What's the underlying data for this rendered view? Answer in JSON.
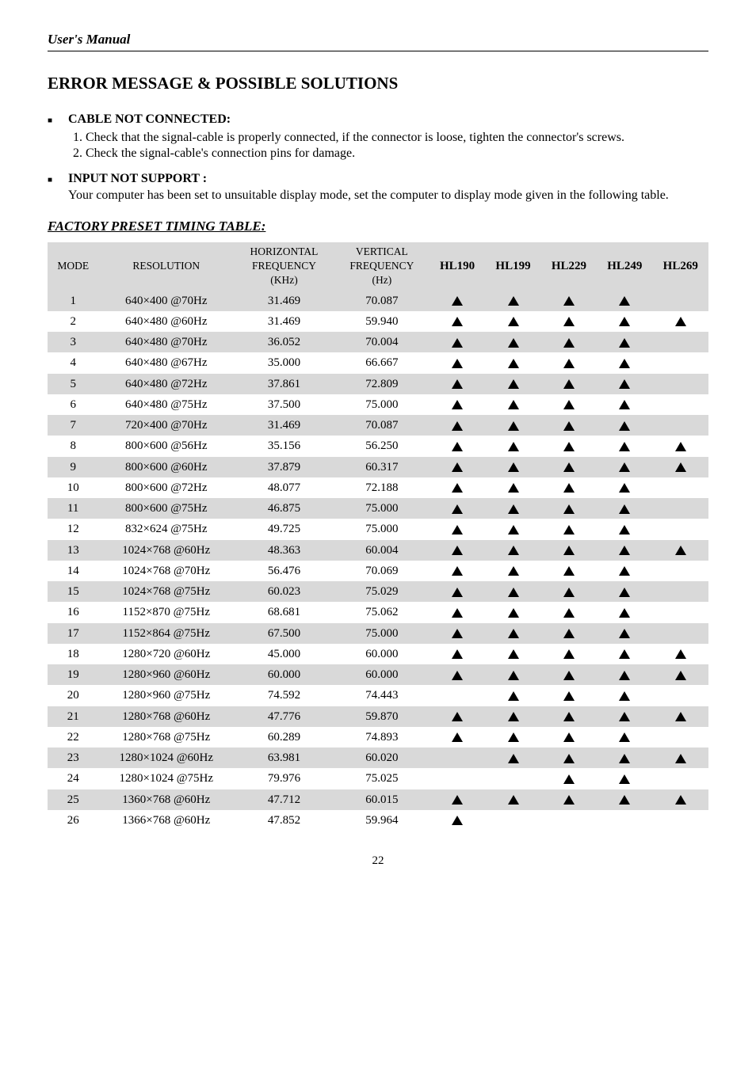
{
  "header": {
    "manual_title": "User's Manual"
  },
  "title": "ERROR MESSAGE & POSSIBLE SOLUTIONS",
  "sections": [
    {
      "heading": "CABLE NOT CONNECTED:",
      "items": [
        "Check that the signal-cable is properly connected, if the connector is loose, tighten the connector's screws.",
        "Check the signal-cable's connection pins for damage."
      ]
    },
    {
      "heading": "INPUT NOT SUPPORT :",
      "paragraph": "Your computer has been set to unsuitable display mode, set the computer to display mode given in the following table."
    }
  ],
  "table_title": "FACTORY PRESET TIMING TABLE:",
  "columns": {
    "mode": "MODE",
    "resolution": "RESOLUTION",
    "hfreq_top": "HORIZONTAL",
    "hfreq_mid": "FREQUENCY",
    "hfreq_unit": "(KHz)",
    "vfreq_top": "VERTICAL",
    "vfreq_mid": "FREQUENCY",
    "vfreq_unit": "(Hz)",
    "models": [
      "HL190",
      "HL199",
      "HL229",
      "HL249",
      "HL269"
    ]
  },
  "chart_data": {
    "type": "table",
    "rows": [
      {
        "mode": 1,
        "resolution": "640×400 @70Hz",
        "hfreq": "31.469",
        "vfreq": "70.087",
        "HL190": true,
        "HL199": true,
        "HL229": true,
        "HL249": true,
        "HL269": false
      },
      {
        "mode": 2,
        "resolution": "640×480 @60Hz",
        "hfreq": "31.469",
        "vfreq": "59.940",
        "HL190": true,
        "HL199": true,
        "HL229": true,
        "HL249": true,
        "HL269": true
      },
      {
        "mode": 3,
        "resolution": "640×480 @70Hz",
        "hfreq": "36.052",
        "vfreq": "70.004",
        "HL190": true,
        "HL199": true,
        "HL229": true,
        "HL249": true,
        "HL269": false
      },
      {
        "mode": 4,
        "resolution": "640×480 @67Hz",
        "hfreq": "35.000",
        "vfreq": "66.667",
        "HL190": true,
        "HL199": true,
        "HL229": true,
        "HL249": true,
        "HL269": false
      },
      {
        "mode": 5,
        "resolution": "640×480 @72Hz",
        "hfreq": "37.861",
        "vfreq": "72.809",
        "HL190": true,
        "HL199": true,
        "HL229": true,
        "HL249": true,
        "HL269": false
      },
      {
        "mode": 6,
        "resolution": "640×480 @75Hz",
        "hfreq": "37.500",
        "vfreq": "75.000",
        "HL190": true,
        "HL199": true,
        "HL229": true,
        "HL249": true,
        "HL269": false
      },
      {
        "mode": 7,
        "resolution": "720×400 @70Hz",
        "hfreq": "31.469",
        "vfreq": "70.087",
        "HL190": true,
        "HL199": true,
        "HL229": true,
        "HL249": true,
        "HL269": false
      },
      {
        "mode": 8,
        "resolution": "800×600 @56Hz",
        "hfreq": "35.156",
        "vfreq": "56.250",
        "HL190": true,
        "HL199": true,
        "HL229": true,
        "HL249": true,
        "HL269": true
      },
      {
        "mode": 9,
        "resolution": "800×600 @60Hz",
        "hfreq": "37.879",
        "vfreq": "60.317",
        "HL190": true,
        "HL199": true,
        "HL229": true,
        "HL249": true,
        "HL269": true
      },
      {
        "mode": 10,
        "resolution": "800×600 @72Hz",
        "hfreq": "48.077",
        "vfreq": "72.188",
        "HL190": true,
        "HL199": true,
        "HL229": true,
        "HL249": true,
        "HL269": false
      },
      {
        "mode": 11,
        "resolution": "800×600 @75Hz",
        "hfreq": "46.875",
        "vfreq": "75.000",
        "HL190": true,
        "HL199": true,
        "HL229": true,
        "HL249": true,
        "HL269": false
      },
      {
        "mode": 12,
        "resolution": "832×624 @75Hz",
        "hfreq": "49.725",
        "vfreq": "75.000",
        "HL190": true,
        "HL199": true,
        "HL229": true,
        "HL249": true,
        "HL269": false
      },
      {
        "mode": 13,
        "resolution": "1024×768 @60Hz",
        "hfreq": "48.363",
        "vfreq": "60.004",
        "HL190": true,
        "HL199": true,
        "HL229": true,
        "HL249": true,
        "HL269": true
      },
      {
        "mode": 14,
        "resolution": "1024×768 @70Hz",
        "hfreq": "56.476",
        "vfreq": "70.069",
        "HL190": true,
        "HL199": true,
        "HL229": true,
        "HL249": true,
        "HL269": false
      },
      {
        "mode": 15,
        "resolution": "1024×768 @75Hz",
        "hfreq": "60.023",
        "vfreq": "75.029",
        "HL190": true,
        "HL199": true,
        "HL229": true,
        "HL249": true,
        "HL269": false
      },
      {
        "mode": 16,
        "resolution": "1152×870 @75Hz",
        "hfreq": "68.681",
        "vfreq": "75.062",
        "HL190": true,
        "HL199": true,
        "HL229": true,
        "HL249": true,
        "HL269": false
      },
      {
        "mode": 17,
        "resolution": "1152×864 @75Hz",
        "hfreq": "67.500",
        "vfreq": "75.000",
        "HL190": true,
        "HL199": true,
        "HL229": true,
        "HL249": true,
        "HL269": false
      },
      {
        "mode": 18,
        "resolution": "1280×720 @60Hz",
        "hfreq": "45.000",
        "vfreq": "60.000",
        "HL190": true,
        "HL199": true,
        "HL229": true,
        "HL249": true,
        "HL269": true
      },
      {
        "mode": 19,
        "resolution": "1280×960 @60Hz",
        "hfreq": "60.000",
        "vfreq": "60.000",
        "HL190": true,
        "HL199": true,
        "HL229": true,
        "HL249": true,
        "HL269": true
      },
      {
        "mode": 20,
        "resolution": "1280×960 @75Hz",
        "hfreq": "74.592",
        "vfreq": "74.443",
        "HL190": false,
        "HL199": true,
        "HL229": true,
        "HL249": true,
        "HL269": false
      },
      {
        "mode": 21,
        "resolution": "1280×768 @60Hz",
        "hfreq": "47.776",
        "vfreq": "59.870",
        "HL190": true,
        "HL199": true,
        "HL229": true,
        "HL249": true,
        "HL269": true
      },
      {
        "mode": 22,
        "resolution": "1280×768 @75Hz",
        "hfreq": "60.289",
        "vfreq": "74.893",
        "HL190": true,
        "HL199": true,
        "HL229": true,
        "HL249": true,
        "HL269": false
      },
      {
        "mode": 23,
        "resolution": "1280×1024 @60Hz",
        "hfreq": "63.981",
        "vfreq": "60.020",
        "HL190": false,
        "HL199": true,
        "HL229": true,
        "HL249": true,
        "HL269": true
      },
      {
        "mode": 24,
        "resolution": "1280×1024 @75Hz",
        "hfreq": "79.976",
        "vfreq": "75.025",
        "HL190": false,
        "HL199": false,
        "HL229": true,
        "HL249": true,
        "HL269": false
      },
      {
        "mode": 25,
        "resolution": "1360×768 @60Hz",
        "hfreq": "47.712",
        "vfreq": "60.015",
        "HL190": true,
        "HL199": true,
        "HL229": true,
        "HL249": true,
        "HL269": true
      },
      {
        "mode": 26,
        "resolution": "1366×768 @60Hz",
        "hfreq": "47.852",
        "vfreq": "59.964",
        "HL190": true,
        "HL199": false,
        "HL229": false,
        "HL249": false,
        "HL269": false
      }
    ]
  },
  "page_number": "22"
}
